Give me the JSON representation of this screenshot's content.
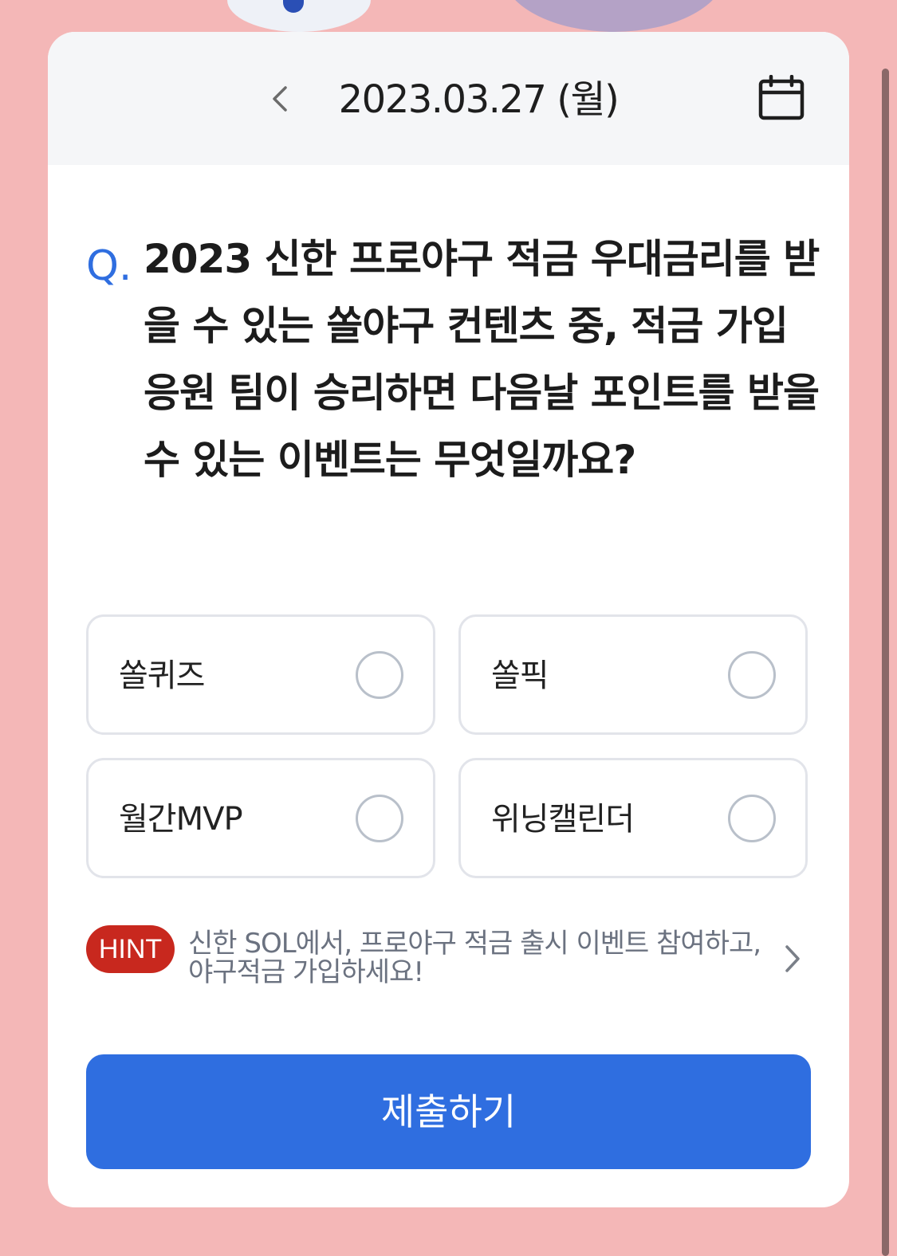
{
  "header": {
    "date": "2023.03.27 (월)"
  },
  "question": {
    "marker": "Q.",
    "text": "2023 신한 프로야구 적금 우대금리를 받을 수 있는 쏠야구 컨텐츠 중, 적금 가입 응원 팀이 승리하면 다음날 포인트를 받을 수 있는 이벤트는 무엇일까요?"
  },
  "options": [
    {
      "label": "쏠퀴즈",
      "selected": false
    },
    {
      "label": "쏠픽",
      "selected": false
    },
    {
      "label": "월간MVP",
      "selected": false
    },
    {
      "label": "위닝캘린더",
      "selected": false
    }
  ],
  "hint": {
    "badge": "HINT",
    "text": "신한 SOL에서, 프로야구 적금 출시 이벤트 참여하고, 야구적금 가입하세요!"
  },
  "submit": {
    "label": "제출하기"
  },
  "colors": {
    "page_background": "#f4b7b7",
    "accent_blue": "#2f6ee0",
    "hint_red": "#c8281e"
  }
}
